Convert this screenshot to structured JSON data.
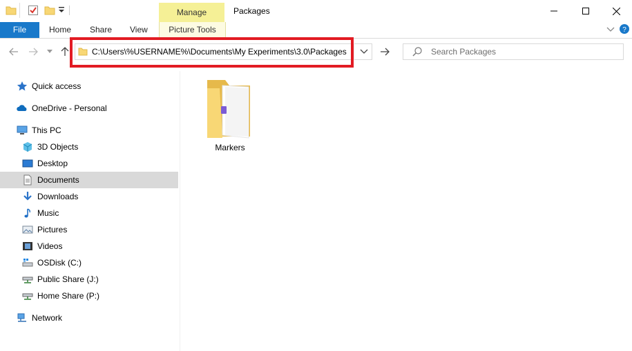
{
  "window": {
    "title": "Packages",
    "contextual_tab": "Manage",
    "contextual_group": "Picture Tools"
  },
  "ribbon": {
    "tabs": [
      "File",
      "Home",
      "Share",
      "View"
    ]
  },
  "address": {
    "path": "C:\\Users\\%USERNAME%\\Documents\\My Experiments\\3.0\\Packages"
  },
  "search": {
    "placeholder": "Search Packages"
  },
  "sidebar": {
    "items": [
      {
        "label": "Quick access",
        "icon": "star-icon"
      },
      {
        "label": "OneDrive - Personal",
        "icon": "cloud-icon"
      },
      {
        "label": "This PC",
        "icon": "computer-icon"
      },
      {
        "label": "3D Objects",
        "icon": "cube-icon"
      },
      {
        "label": "Desktop",
        "icon": "desktop-icon"
      },
      {
        "label": "Documents",
        "icon": "document-icon",
        "selected": true
      },
      {
        "label": "Downloads",
        "icon": "download-icon"
      },
      {
        "label": "Music",
        "icon": "music-icon"
      },
      {
        "label": "Pictures",
        "icon": "pictures-icon"
      },
      {
        "label": "Videos",
        "icon": "video-icon"
      },
      {
        "label": "OSDisk (C:)",
        "icon": "disk-icon"
      },
      {
        "label": "Public Share (J:)",
        "icon": "network-drive-icon"
      },
      {
        "label": "Home Share (P:)",
        "icon": "network-drive-icon"
      },
      {
        "label": "Network",
        "icon": "network-icon"
      }
    ]
  },
  "content": {
    "items": [
      {
        "label": "Markers",
        "icon": "folder-icon"
      }
    ]
  },
  "colors": {
    "file_tab": "#1979ca",
    "manage_tab": "#f5f096",
    "highlight": "#e21b23",
    "selection": "#d9d9d9"
  }
}
